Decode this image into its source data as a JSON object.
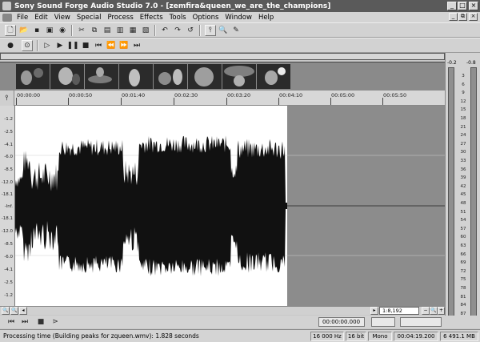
{
  "window": {
    "title": "Sony Sound Forge Audio Studio 7.0 - [zemfira&queen_we_are_the_champions]",
    "controls": {
      "minimize": "_",
      "maximize": "□",
      "close": "×"
    }
  },
  "menu": {
    "items": [
      "File",
      "Edit",
      "View",
      "Special",
      "Process",
      "Effects",
      "Tools",
      "Options",
      "Window",
      "Help"
    ],
    "mdi_controls": {
      "minimize": "_",
      "restore": "⧉",
      "close": "×"
    }
  },
  "ruler": {
    "labels": [
      "00:00:00",
      "00:00:50",
      "00:01:40",
      "00:02:30",
      "00:03:20",
      "00:04:10",
      "00:05:00",
      "00:05:50"
    ]
  },
  "db_scale": {
    "labels": [
      "-1.2",
      "-2.5",
      "-4.1",
      "-6.0",
      "-8.5",
      "-12.0",
      "-18.1",
      "-Inf.",
      "-18.1",
      "-12.0",
      "-8.5",
      "-6.0",
      "-4.1",
      "-2.5",
      "-1.2"
    ]
  },
  "meters": {
    "left_top": "-0.2",
    "right_top": "-0.8",
    "labels": [
      "3",
      "6",
      "9",
      "12",
      "15",
      "18",
      "21",
      "24",
      "27",
      "30",
      "33",
      "36",
      "39",
      "42",
      "45",
      "48",
      "51",
      "54",
      "57",
      "60",
      "63",
      "66",
      "69",
      "72",
      "75",
      "78",
      "81",
      "84",
      "87"
    ]
  },
  "zoom": {
    "value": "1:8,192"
  },
  "transport": {
    "selection_start": "00:00:00.000"
  },
  "status": {
    "message": "Processing time (Building peaks for zqueen.wmv): 1.828 seconds",
    "sample_rate": "16 000 Hz",
    "bit_depth": "16 bit",
    "channels": "Mono",
    "length": "00:04:19.200",
    "free_space": "6 491.1 MB"
  },
  "colors": {
    "waveform": "#111111",
    "wave_bg": "#ffffff",
    "empty_bg": "#8c8c8c",
    "title_bar": "#5a5a5a"
  },
  "icons": {
    "toolbar1": [
      "new-icon",
      "open-icon",
      "save-icon",
      "save-as-icon",
      "properties-icon",
      "cut-icon",
      "copy-icon",
      "paste-icon",
      "paste-special-icon",
      "mix-icon",
      "crop-icon",
      "undo-icon",
      "redo-icon",
      "repeat-icon",
      "edit-tool-icon",
      "magnify-tool-icon",
      "pencil-tool-icon"
    ],
    "toolbar2": [
      "record-icon",
      "loop-icon",
      "play-all-icon",
      "play-icon",
      "pause-icon",
      "stop-icon",
      "go-start-icon",
      "rewind-icon",
      "forward-icon",
      "go-end-icon"
    ]
  }
}
